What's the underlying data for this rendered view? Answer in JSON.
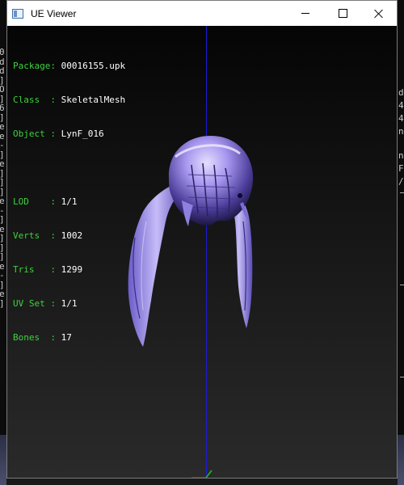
{
  "background": {
    "left_chars": [
      "0",
      "d",
      "d",
      "]",
      "O",
      "]",
      "6",
      "]",
      "e",
      "e",
      "-",
      "]",
      "e",
      "]",
      "]",
      "]",
      "e",
      "-",
      "]",
      "e",
      "]",
      "]",
      "]",
      "e",
      "-",
      "]",
      "e",
      "]"
    ],
    "right_chars": [
      "d",
      "4",
      "4",
      "n",
      "n",
      "F",
      "/"
    ]
  },
  "window": {
    "title": "UE Viewer",
    "controls": {
      "minimize": "minimize",
      "maximize": "maximize",
      "close": "close"
    }
  },
  "info": {
    "package_label": "Package",
    "package_value": "00016155.upk",
    "class_label": "Class  ",
    "class_value": "SkeletalMesh",
    "object_label": "Object ",
    "object_value": "LynF_016",
    "lod_label": "LOD    ",
    "lod_value": "1/1",
    "verts_label": "Verts  ",
    "verts_value": "1002",
    "tris_label": "Tris   ",
    "tris_value": "1299",
    "uvset_label": "UV Set ",
    "uvset_value": "1/1",
    "bones_label": "Bones  ",
    "bones_value": "17"
  },
  "colors": {
    "info_label": "#3ed23e",
    "info_value": "#ffffff",
    "axis_z": "#1c1cd8",
    "axis_x": "#d82020",
    "axis_y": "#20c020",
    "mesh": "#9c8ef0"
  }
}
